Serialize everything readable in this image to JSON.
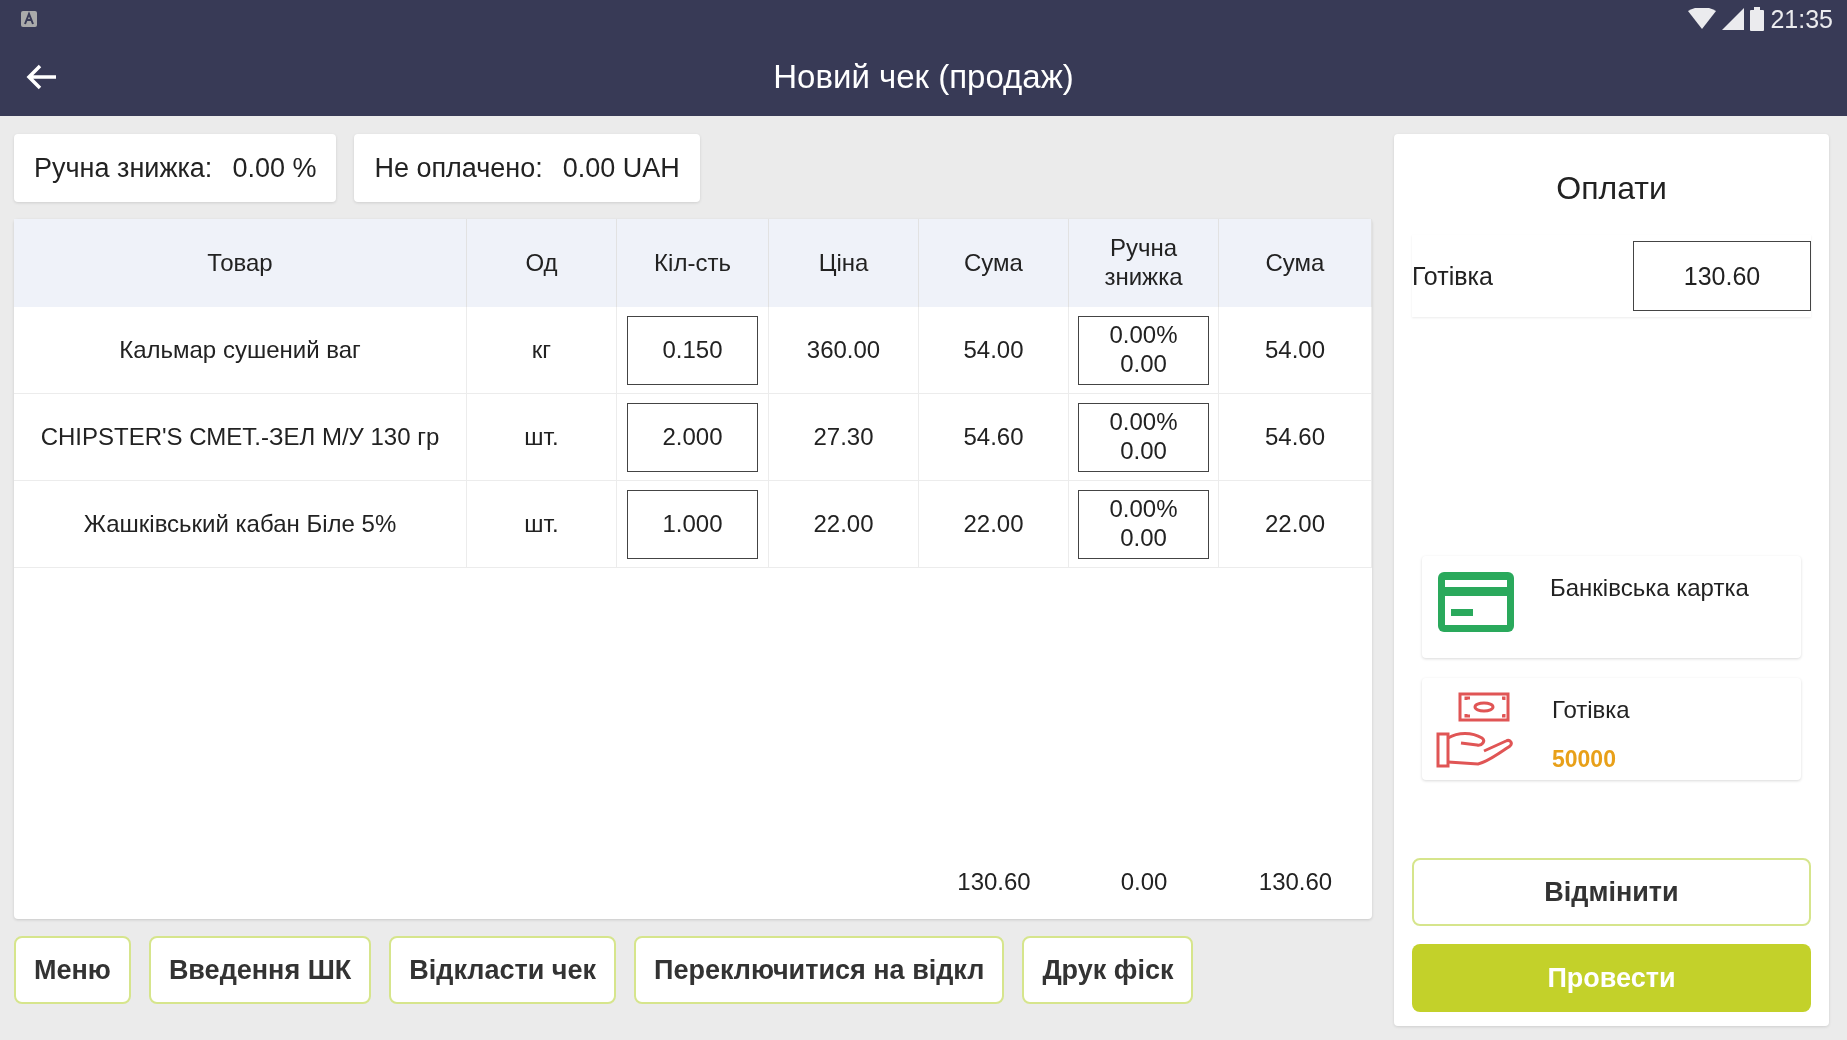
{
  "status_bar": {
    "time": "21:35"
  },
  "app_bar": {
    "title": "Новий чек (продаж)"
  },
  "summary": [
    {
      "label": "Ручна знижка:",
      "value": "0.00 %"
    },
    {
      "label": "Не оплачено:",
      "value": "0.00 UAH"
    }
  ],
  "table": {
    "columns": [
      {
        "label": "Товар",
        "kind": "text"
      },
      {
        "label": "Од",
        "kind": "text"
      },
      {
        "label": "Кіл-сть",
        "kind": "input"
      },
      {
        "label": "Ціна",
        "kind": "text"
      },
      {
        "label": "Сума",
        "kind": "text"
      },
      {
        "label": "Ручна знижка",
        "kind": "discount"
      },
      {
        "label": "Сума",
        "kind": "text"
      }
    ],
    "rows": [
      {
        "cells": [
          "Кальмар сушений ваг",
          "кг",
          "0.150",
          "360.00",
          "54.00",
          [
            "0.00%",
            "0.00"
          ],
          "54.00"
        ]
      },
      {
        "cells": [
          "CHIPSTER'S СМЕТ.-ЗЕЛ М/У 130 гр",
          "шт.",
          "2.000",
          "27.30",
          "54.60",
          [
            "0.00%",
            "0.00"
          ],
          "54.60"
        ]
      },
      {
        "cells": [
          "Жашківський кабан Біле 5%",
          "шт.",
          "1.000",
          "22.00",
          "22.00",
          [
            "0.00%",
            "0.00"
          ],
          "22.00"
        ]
      }
    ],
    "totals": [
      "130.60",
      "0.00",
      "130.60"
    ]
  },
  "actions": [
    "Меню",
    "Введення ШК",
    "Відкласти чек",
    "Переключитися на відкл",
    "Друк фіск"
  ],
  "payments": {
    "title": "Оплати",
    "entries": [
      {
        "label": "Готівка",
        "value": "130.60"
      }
    ],
    "methods": [
      {
        "kind": "card",
        "label": "Банківська картка"
      },
      {
        "kind": "cash",
        "label": "Готівка",
        "amount": "50000"
      }
    ],
    "cancel": "Відмінити",
    "submit": "Провести"
  }
}
